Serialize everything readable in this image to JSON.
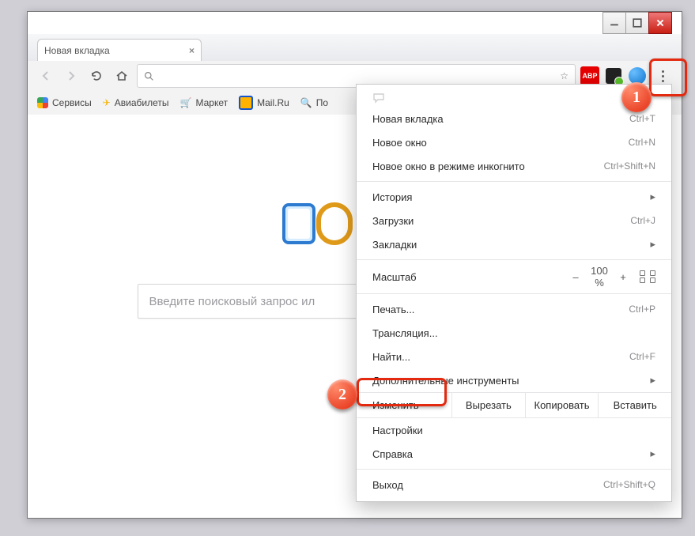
{
  "window": {
    "tab_title": "Новая вкладка",
    "omnibox_value": "",
    "omnibox_placeholder": ""
  },
  "bookmarks": [
    {
      "label": "Сервисы",
      "icon": "grid"
    },
    {
      "label": "Авиабилеты",
      "icon": "plane"
    },
    {
      "label": "Маркет",
      "icon": "cart"
    },
    {
      "label": "Mail.Ru",
      "icon": "mailru"
    },
    {
      "label": "По",
      "icon": "search"
    }
  ],
  "search": {
    "placeholder": "Введите поисковый запрос ил"
  },
  "menu": {
    "new_tab": "Новая вкладка",
    "new_tab_sc": "Ctrl+T",
    "new_window": "Новое окно",
    "new_window_sc": "Ctrl+N",
    "incognito": "Новое окно в режиме инкогнито",
    "incognito_sc": "Ctrl+Shift+N",
    "history": "История",
    "downloads": "Загрузки",
    "downloads_sc": "Ctrl+J",
    "bookmarks": "Закладки",
    "zoom_label": "Масштаб",
    "zoom_minus": "–",
    "zoom_value": "100 %",
    "zoom_plus": "+",
    "print": "Печать...",
    "print_sc": "Ctrl+P",
    "cast": "Трансляция...",
    "find": "Найти...",
    "find_sc": "Ctrl+F",
    "more_tools": "Дополнительные инструменты",
    "edit_label": "Изменить",
    "cut": "Вырезать",
    "copy": "Копировать",
    "paste": "Вставить",
    "settings": "Настройки",
    "help": "Справка",
    "exit": "Выход",
    "exit_sc": "Ctrl+Shift+Q"
  },
  "callouts": {
    "one": "1",
    "two": "2"
  },
  "ext": {
    "abp": "ABP"
  }
}
